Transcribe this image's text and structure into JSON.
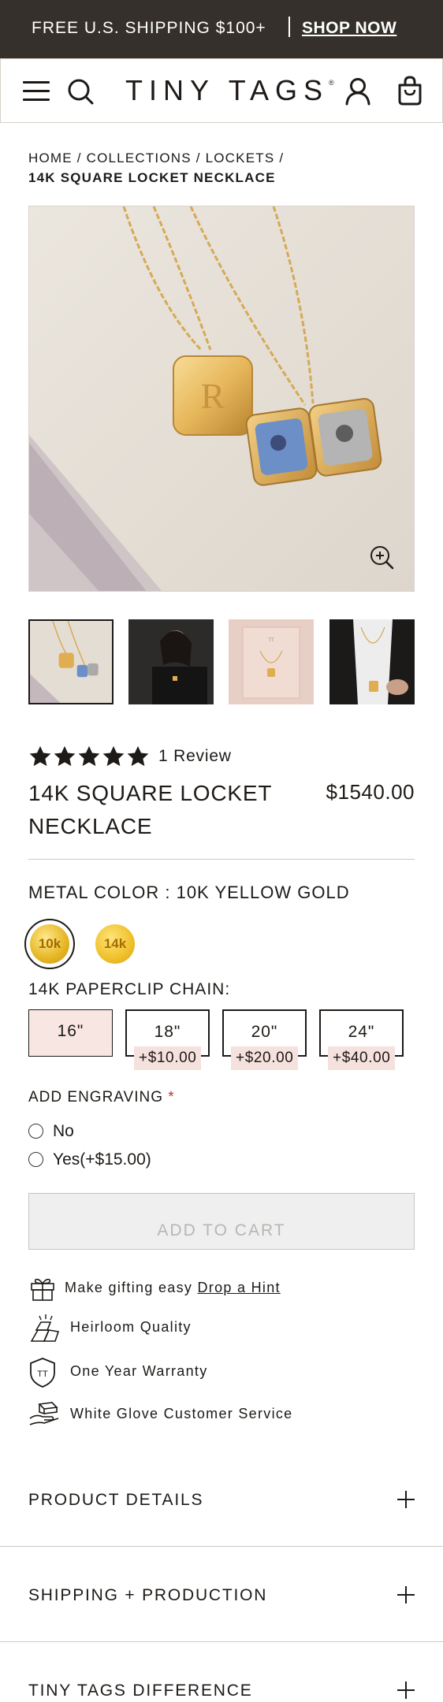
{
  "announcement": {
    "shipping_text": "FREE U.S. SHIPPING $100+",
    "shop_now": "SHOP NOW"
  },
  "header": {
    "logo": "TINY TAGS",
    "logo_mark": "®",
    "icons": [
      "menu-icon",
      "search-icon",
      "account-icon",
      "bag-icon"
    ]
  },
  "breadcrumb": {
    "items": [
      "HOME",
      "COLLECTIONS",
      "LOCKETS"
    ],
    "separator": "/",
    "current": "14K SQUARE LOCKET NECKLACE"
  },
  "gallery": {
    "main_locket_initial": "R",
    "thumbnail_count": 4,
    "icons": [
      "zoom-in-icon"
    ]
  },
  "product": {
    "rating": 5,
    "review_count": "1 Review",
    "title_line1": "14K SQUARE LOCKET",
    "title_line2": "NECKLACE",
    "price": "$1540.00"
  },
  "options": {
    "metal_color_label": "METAL COLOR : 10K YELLOW GOLD",
    "metal_swatches": [
      {
        "label": "10k",
        "selected": true
      },
      {
        "label": "14k",
        "selected": false
      }
    ],
    "chain_label": "14K PAPERCLIP CHAIN:",
    "chains": [
      {
        "length": "16\"",
        "upcharge": "",
        "selected": true
      },
      {
        "length": "18\"",
        "upcharge": "+$10.00",
        "selected": false
      },
      {
        "length": "20\"",
        "upcharge": "+$20.00",
        "selected": false
      },
      {
        "length": "24\"",
        "upcharge": "+$40.00",
        "selected": false
      }
    ],
    "engraving_label": "ADD ENGRAVING",
    "required_mark": "*",
    "engraving_options": [
      "No",
      "Yes(+$15.00)"
    ]
  },
  "cart": {
    "add_to_cart": "ADD TO CART"
  },
  "features": {
    "gift_text": "Make gifting easy",
    "gift_link": "Drop a Hint",
    "heirloom": "Heirloom Quality",
    "warranty": "One Year Warranty",
    "warranty_badge": "TT",
    "service": "White Glove Customer Service"
  },
  "accordions": [
    "PRODUCT DETAILS",
    "SHIPPING + PRODUCTION",
    "TINY TAGS DIFFERENCE"
  ],
  "colors": {
    "announcement_bg": "#35302b",
    "selected_chain_bg": "#f7e6e1",
    "upcharge_bg": "#f5e1dd",
    "required": "#c6322b",
    "gold": "#e0ad38"
  }
}
